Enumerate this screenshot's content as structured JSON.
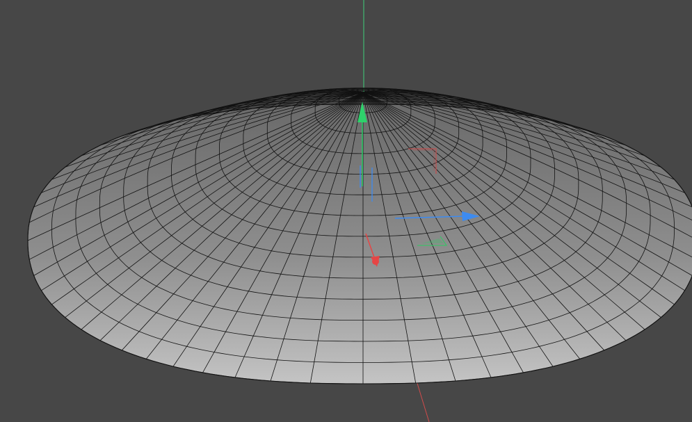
{
  "viewport": {
    "background": "#474747",
    "mesh_fill_light": "#c4c4c4",
    "mesh_fill_mid": "#8f8f8f",
    "mesh_fill_dark": "#6a6a6a",
    "mesh_wire_color": "#111111"
  },
  "mesh": {
    "object": "dome",
    "rings": 14,
    "segments": 60
  },
  "gizmo": {
    "x_axis_color": "#e64545",
    "y_axis_color": "#2ed16b",
    "z_axis_color": "#3d8bf0",
    "plane_xy_color": "#c05050",
    "plane_xz_color": "#3fbf6a",
    "plane_yz_color": "#3d8bf0",
    "icons": [
      "move-gizmo-icon",
      "x-axis-arrow-icon",
      "y-axis-arrow-icon",
      "z-axis-arrow-icon"
    ]
  },
  "world_axes": {
    "x_axis_color": "#d24b4b",
    "y_axis_color": "#3fd07a",
    "z_axis_color": "#3d8bf0"
  }
}
